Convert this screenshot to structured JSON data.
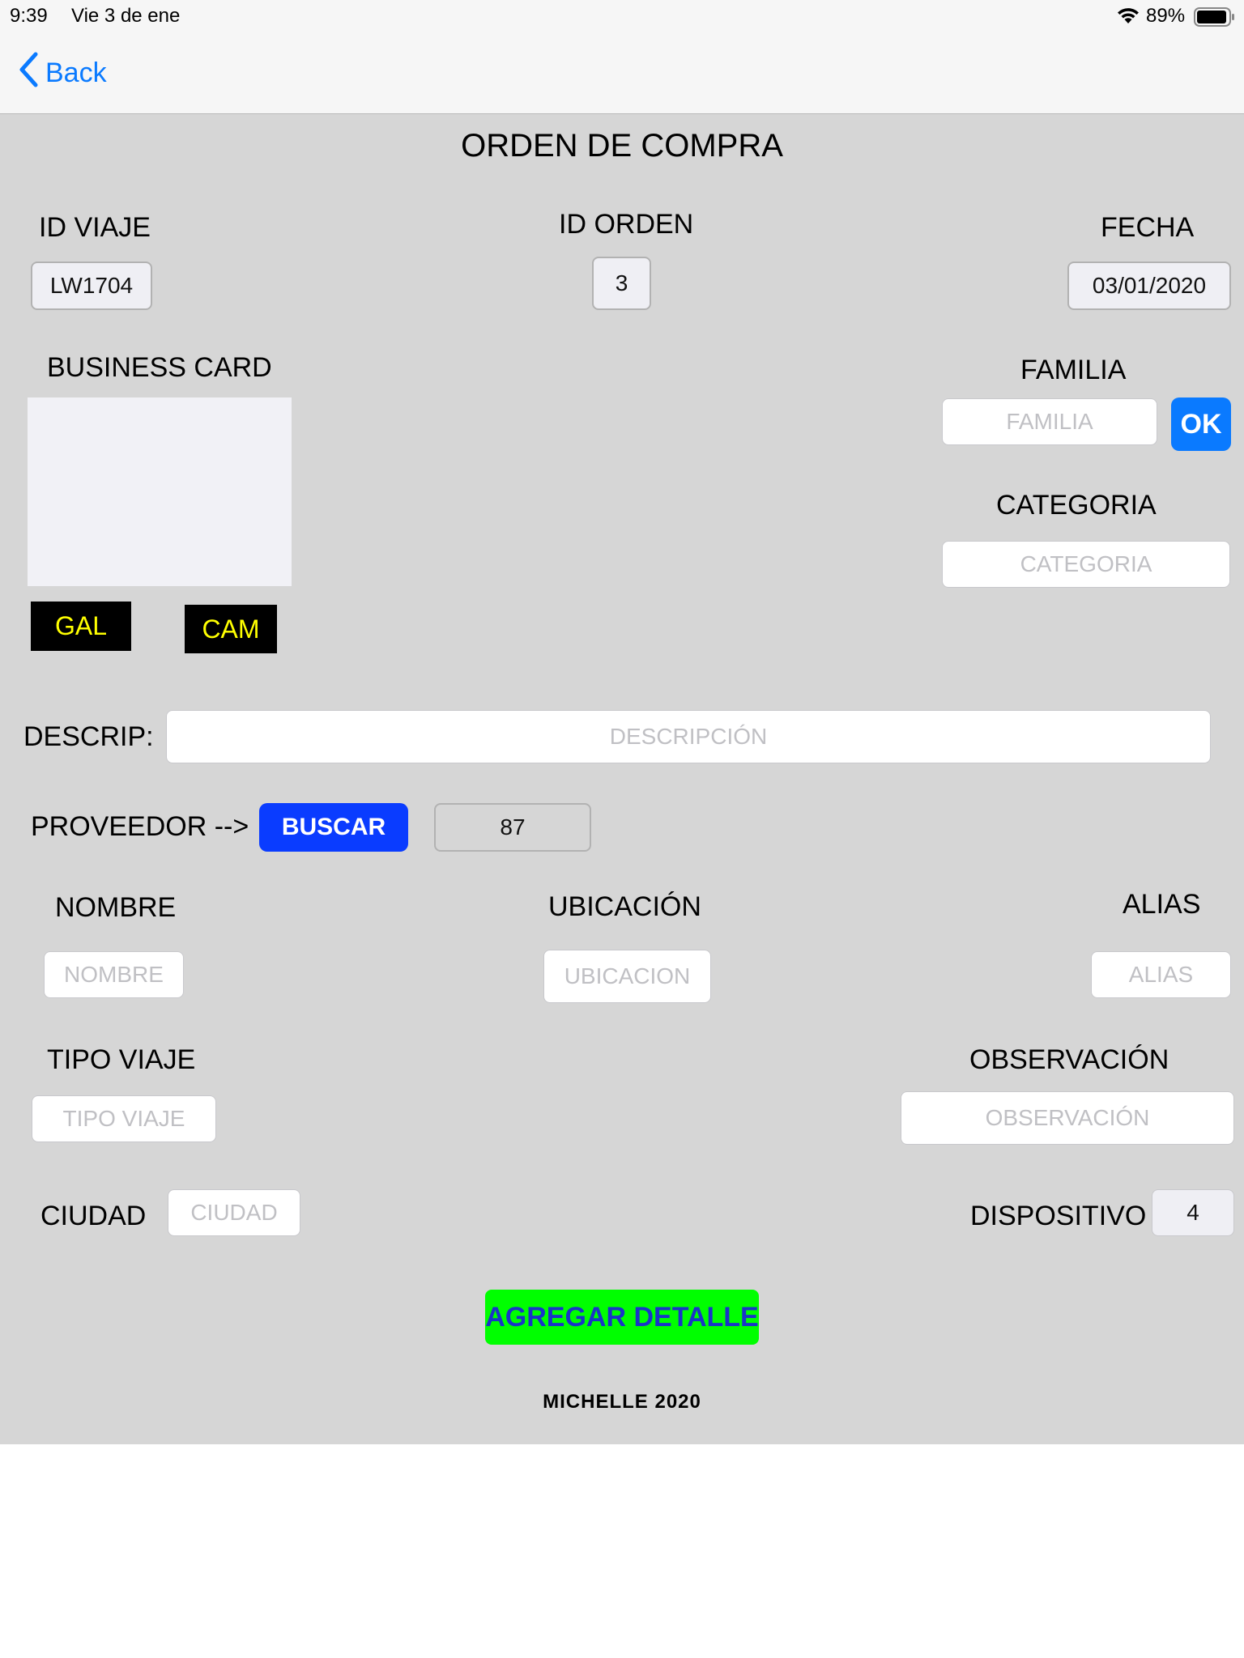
{
  "status_bar": {
    "time": "9:39",
    "date": "Vie 3 de ene",
    "battery": "89%",
    "icons": [
      "wifi-icon",
      "battery-icon"
    ]
  },
  "nav": {
    "back_label": "Back",
    "icon": "chevron-left-icon"
  },
  "form": {
    "title": "ORDEN DE COMPRA",
    "id_viaje": {
      "label": "ID VIAJE",
      "value": "LW1704"
    },
    "id_orden": {
      "label": "ID ORDEN",
      "value": "3"
    },
    "fecha": {
      "label": "FECHA",
      "value": "03/01/2020"
    },
    "business_card": {
      "label": "BUSINESS CARD"
    },
    "gal_button": "GAL",
    "cam_button": "CAM",
    "familia": {
      "label": "FAMILIA",
      "placeholder": "FAMILIA",
      "ok_label": "OK"
    },
    "categoria": {
      "label": "CATEGORIA",
      "placeholder": "CATEGORIA"
    },
    "descrip": {
      "label": "DESCRIP:",
      "placeholder": "DESCRIPCIÓN"
    },
    "proveedor": {
      "label": "PROVEEDOR -->",
      "buscar_label": "BUSCAR",
      "value": "87"
    },
    "nombre": {
      "label": "NOMBRE",
      "placeholder": "NOMBRE"
    },
    "ubicacion": {
      "label": "UBICACIÓN",
      "placeholder": "UBICACION"
    },
    "alias": {
      "label": "ALIAS",
      "placeholder": "ALIAS"
    },
    "tipo_viaje": {
      "label": "TIPO VIAJE",
      "placeholder": "TIPO VIAJE"
    },
    "observacion": {
      "label": "OBSERVACIÓN",
      "placeholder": "OBSERVACIÓN"
    },
    "ciudad": {
      "label": "CIUDAD",
      "placeholder": "CIUDAD"
    },
    "dispositivo": {
      "label": "DISPOSITIVO",
      "value": "4"
    },
    "agregar_label": "AGREGAR DETALLE",
    "footer": "MICHELLE 2020"
  },
  "colors": {
    "content_bg": "#d6d6d6",
    "ios_blue": "#0a7aff",
    "buscar_blue": "#0a3cff",
    "agregar_green": "#00ff00",
    "agregar_text": "#1a34c8",
    "cam_text_yellow": "#ffff00"
  }
}
